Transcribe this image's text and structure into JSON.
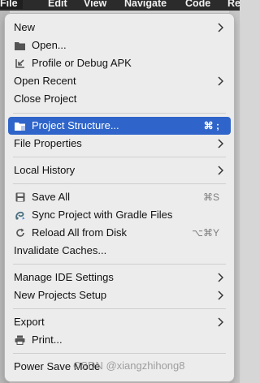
{
  "menubar": {
    "items": [
      "File",
      "Edit",
      "View",
      "Navigate",
      "Code",
      "Re"
    ]
  },
  "menu": {
    "items": [
      {
        "label": "New",
        "submenu": true
      },
      {
        "label": "Open...",
        "icon": "folder-icon"
      },
      {
        "label": "Profile or Debug APK",
        "icon": "import-arrow-icon"
      },
      {
        "label": "Open Recent",
        "submenu": true
      },
      {
        "label": "Close Project"
      },
      {
        "label": "Project Structure...",
        "icon": "project-structure-icon",
        "shortcut": "⌘ ;",
        "selected": true
      },
      {
        "label": "File Properties",
        "submenu": true
      },
      {
        "label": "Local History",
        "submenu": true
      },
      {
        "label": "Save All",
        "icon": "save-icon",
        "shortcut": "⌘S"
      },
      {
        "label": "Sync Project with Gradle Files",
        "icon": "gradle-sync-icon"
      },
      {
        "label": "Reload All from Disk",
        "icon": "reload-icon",
        "shortcut": "⌥⌘Y"
      },
      {
        "label": "Invalidate Caches..."
      },
      {
        "label": "Manage IDE Settings",
        "submenu": true
      },
      {
        "label": "New Projects Setup",
        "submenu": true
      },
      {
        "label": "Export",
        "submenu": true
      },
      {
        "label": "Print...",
        "icon": "printer-icon"
      },
      {
        "label": "Power Save Mode"
      }
    ]
  },
  "watermark": "CSDN @xiangzhihong8",
  "colors": {
    "selection": "#2f65ca",
    "menu_bg": "#ececec",
    "menubar_bg": "#2b2b2b"
  }
}
